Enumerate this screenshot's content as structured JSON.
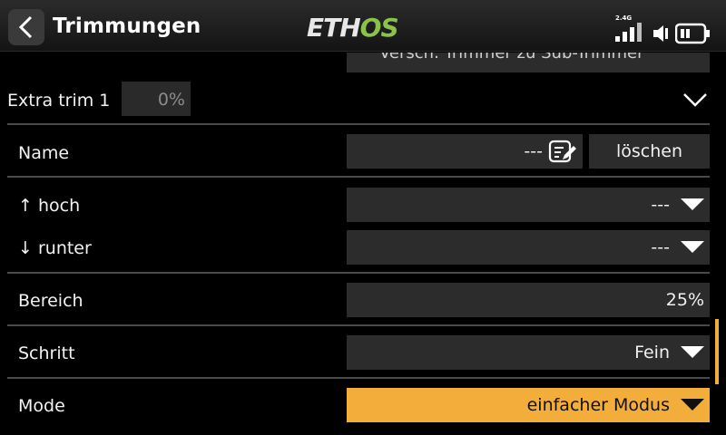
{
  "header": {
    "back_icon": "chevron-left-icon",
    "title": "Trimmungen",
    "logo": {
      "part1": "ETH",
      "part2": "OS"
    },
    "status": {
      "band": "2.4G",
      "signal_icon": "signal-bars-icon",
      "sound_icon": "speaker-icon",
      "battery_icon": "battery-icon"
    }
  },
  "prev_row_text": "Versch. Trimmer zu Sub-Trimmer",
  "section": {
    "label": "Extra trim 1",
    "value": "0%",
    "collapse_icon": "chevron-down-icon"
  },
  "rows": {
    "name": {
      "label": "Name",
      "value": "---",
      "edit_icon": "edit-icon",
      "delete_label": "löschen"
    },
    "up": {
      "label": "↑ hoch",
      "value": "---"
    },
    "down": {
      "label": "↓ runter",
      "value": "---"
    },
    "range": {
      "label": "Bereich",
      "value": "25%"
    },
    "step": {
      "label": "Schritt",
      "value": "Fein"
    },
    "mode": {
      "label": "Mode",
      "value": "einfacher Modus"
    }
  },
  "colors": {
    "accent": "#f2ad3a",
    "logo_green": "#8bc34a",
    "field_bg": "#2c2c2c"
  }
}
